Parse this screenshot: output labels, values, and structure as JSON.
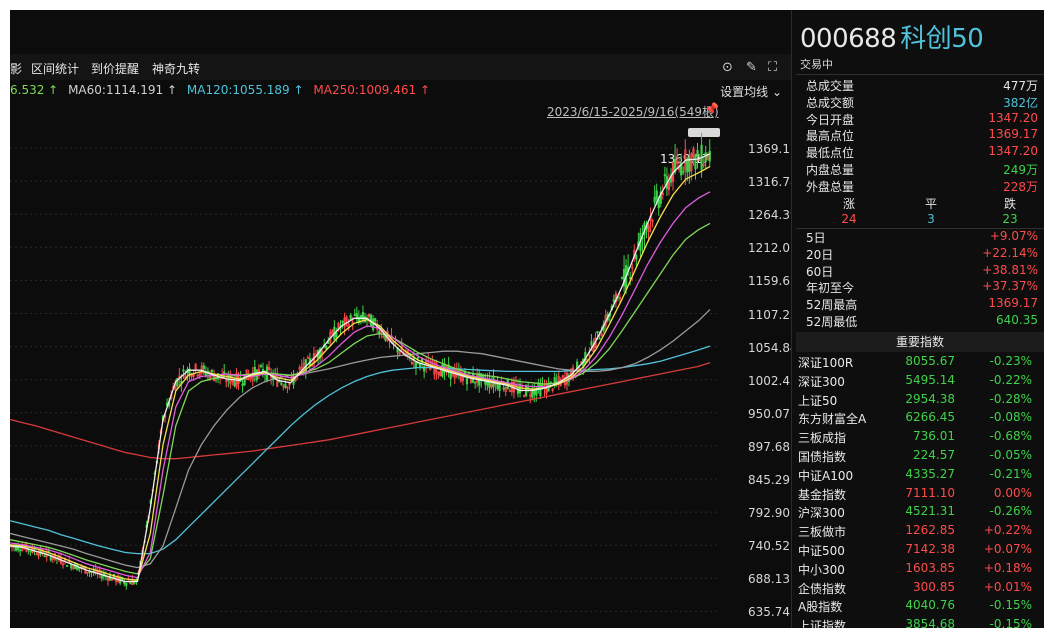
{
  "toolbar": {
    "items": [
      "影",
      "区间统计",
      "到价提醒",
      "神奇九转"
    ],
    "icons": [
      "settings-circle-icon",
      "draw-icon",
      "fullscreen-icon"
    ]
  },
  "ma": {
    "ma30_partial": "6.532 ↑",
    "ma60": "MA60:1114.191 ↑",
    "ma120": "MA120:1055.189 ↑",
    "ma250": "MA250:1009.461 ↑",
    "settings_label": "设置均线 ⌄"
  },
  "range": "2023/6/15-2025/9/16(549根)",
  "price_tag": "1369.17",
  "y_ticks": [
    "1369.17",
    "1316.78",
    "1264.39",
    "1212.01",
    "1159.62",
    "1107.23",
    "1054.84",
    "1002.45",
    "950.07",
    "897.68",
    "845.29",
    "792.90",
    "740.52",
    "688.13",
    "635.74"
  ],
  "colors": {
    "up": "#ff4b4b",
    "down": "#3fd24a",
    "ma5": "#f0f0f0",
    "ma10": "#f5e04c",
    "ma20": "#e05ce0",
    "ma30": "#7ed957",
    "ma60": "#9a9a9a",
    "ma120": "#4fc3d9",
    "ma250": "#d73a3a"
  },
  "quote": {
    "code": "000688",
    "name": "科创50",
    "status": "交易中",
    "stats": [
      {
        "label": "总成交量",
        "value": "477万",
        "color": "white"
      },
      {
        "label": "总成交额",
        "value": "382亿",
        "color": "cyan"
      },
      {
        "label": "今日开盘",
        "value": "1347.20",
        "color": "red"
      },
      {
        "label": "最高点位",
        "value": "1369.17",
        "color": "red"
      },
      {
        "label": "最低点位",
        "value": "1347.20",
        "color": "red"
      },
      {
        "label": "内盘总量",
        "value": "249万",
        "color": "green"
      },
      {
        "label": "外盘总量",
        "value": "228万",
        "color": "red"
      }
    ],
    "breadth": {
      "up_label": "涨",
      "flat_label": "平",
      "down_label": "跌",
      "up": "24",
      "flat": "3",
      "down": "23"
    },
    "perf": [
      {
        "label": "5日",
        "value": "+9.07%"
      },
      {
        "label": "20日",
        "value": "+22.14%"
      },
      {
        "label": "60日",
        "value": "+38.81%"
      },
      {
        "label": "年初至今",
        "value": "+37.37%"
      },
      {
        "label": "52周最高",
        "value": "1369.17"
      },
      {
        "label": "52周最低",
        "value": "640.35",
        "color": "green"
      }
    ]
  },
  "indices": {
    "header": "重要指数",
    "rows": [
      {
        "name": "深证100R",
        "price": "8055.67",
        "change": "-0.23%",
        "dir": "down"
      },
      {
        "name": "深证300",
        "price": "5495.14",
        "change": "-0.22%",
        "dir": "down"
      },
      {
        "name": "上证50",
        "price": "2954.38",
        "change": "-0.28%",
        "dir": "down"
      },
      {
        "name": "东方财富全A",
        "price": "6266.45",
        "change": "-0.08%",
        "dir": "down"
      },
      {
        "name": "三板成指",
        "price": "736.01",
        "change": "-0.68%",
        "dir": "down"
      },
      {
        "name": "国债指数",
        "price": "224.57",
        "change": "-0.05%",
        "dir": "down"
      },
      {
        "name": "中证A100",
        "price": "4335.27",
        "change": "-0.21%",
        "dir": "down"
      },
      {
        "name": "基金指数",
        "price": "7111.10",
        "change": "0.00%",
        "dir": "flat"
      },
      {
        "name": "沪深300",
        "price": "4521.31",
        "change": "-0.26%",
        "dir": "down"
      },
      {
        "name": "三板做市",
        "price": "1262.85",
        "change": "+0.22%",
        "dir": "up"
      },
      {
        "name": "中证500",
        "price": "7142.38",
        "change": "+0.07%",
        "dir": "up"
      },
      {
        "name": "中小300",
        "price": "1603.85",
        "change": "+0.18%",
        "dir": "up"
      },
      {
        "name": "企债指数",
        "price": "300.85",
        "change": "+0.01%",
        "dir": "up"
      },
      {
        "name": "A股指数",
        "price": "4040.76",
        "change": "-0.15%",
        "dir": "down"
      },
      {
        "name": "上证指数",
        "price": "3854.68",
        "change": "-0.15%",
        "dir": "down"
      }
    ]
  },
  "chart_data": {
    "type": "line",
    "ylim": [
      635.74,
      1369.17
    ],
    "x": [
      0,
      10,
      20,
      30,
      40,
      50,
      60,
      70,
      80,
      90,
      100,
      110,
      120,
      130,
      140,
      150,
      160,
      170,
      180,
      190,
      200,
      210,
      220,
      230,
      240,
      250,
      260,
      270,
      280,
      290,
      300,
      310,
      320,
      330,
      340,
      350,
      360,
      370,
      380,
      390,
      400,
      410,
      420,
      430,
      440,
      450,
      460,
      470,
      480,
      490,
      500,
      510,
      520,
      530,
      540,
      549
    ],
    "series": [
      {
        "name": "MA250",
        "values": [
          940,
          935,
          930,
          924,
          918,
          912,
          906,
          900,
          894,
          888,
          884,
          880,
          878,
          878,
          880,
          882,
          884,
          886,
          888,
          890,
          893,
          896,
          899,
          902,
          905,
          908,
          912,
          916,
          920,
          924,
          928,
          932,
          936,
          940,
          944,
          948,
          952,
          956,
          960,
          964,
          968,
          972,
          976,
          980,
          984,
          988,
          992,
          996,
          1000,
          1004,
          1008,
          1012,
          1016,
          1020,
          1024,
          1030
        ]
      },
      {
        "name": "MA120",
        "values": [
          780,
          775,
          770,
          765,
          758,
          752,
          746,
          740,
          735,
          730,
          728,
          728,
          735,
          750,
          770,
          790,
          810,
          830,
          850,
          870,
          890,
          910,
          930,
          948,
          964,
          978,
          990,
          1000,
          1008,
          1014,
          1018,
          1020,
          1022,
          1022,
          1021,
          1020,
          1019,
          1018,
          1017,
          1016,
          1016,
          1016,
          1016,
          1016,
          1017,
          1018,
          1019,
          1020,
          1022,
          1025,
          1028,
          1032,
          1038,
          1044,
          1050,
          1056
        ]
      },
      {
        "name": "MA60",
        "values": [
          760,
          755,
          750,
          745,
          740,
          735,
          728,
          722,
          716,
          710,
          706,
          712,
          740,
          800,
          860,
          900,
          930,
          955,
          975,
          990,
          1000,
          1006,
          1010,
          1012,
          1016,
          1020,
          1025,
          1030,
          1034,
          1038,
          1040,
          1042,
          1044,
          1046,
          1048,
          1048,
          1046,
          1044,
          1040,
          1036,
          1032,
          1028,
          1024,
          1020,
          1018,
          1016,
          1016,
          1018,
          1022,
          1028,
          1038,
          1050,
          1064,
          1080,
          1096,
          1114
        ]
      },
      {
        "name": "MA30",
        "values": [
          750,
          746,
          742,
          738,
          732,
          725,
          718,
          712,
          706,
          700,
          696,
          720,
          820,
          930,
          985,
          1000,
          1005,
          1008,
          1010,
          1012,
          1014,
          1012,
          1010,
          1014,
          1020,
          1030,
          1045,
          1060,
          1072,
          1076,
          1070,
          1058,
          1046,
          1036,
          1028,
          1020,
          1014,
          1010,
          1008,
          1004,
          1000,
          998,
          996,
          998,
          1004,
          1014,
          1030,
          1052,
          1080,
          1110,
          1140,
          1170,
          1200,
          1225,
          1240,
          1250
        ]
      },
      {
        "name": "MA20",
        "values": [
          745,
          742,
          738,
          734,
          728,
          720,
          712,
          706,
          700,
          694,
          690,
          730,
          860,
          960,
          1000,
          1008,
          1010,
          1012,
          1010,
          1008,
          1012,
          1010,
          1006,
          1012,
          1024,
          1040,
          1060,
          1078,
          1088,
          1084,
          1070,
          1054,
          1040,
          1030,
          1022,
          1016,
          1010,
          1006,
          1002,
          998,
          994,
          992,
          992,
          996,
          1004,
          1018,
          1040,
          1070,
          1105,
          1145,
          1185,
          1220,
          1250,
          1275,
          1290,
          1300
        ]
      },
      {
        "name": "MA10",
        "values": [
          742,
          740,
          736,
          730,
          722,
          714,
          706,
          700,
          694,
          688,
          686,
          760,
          900,
          985,
          1010,
          1016,
          1012,
          1008,
          1004,
          1010,
          1014,
          1006,
          1002,
          1016,
          1032,
          1054,
          1076,
          1092,
          1098,
          1088,
          1066,
          1048,
          1034,
          1026,
          1020,
          1014,
          1008,
          1004,
          1000,
          996,
          990,
          988,
          990,
          996,
          1006,
          1024,
          1052,
          1090,
          1130,
          1175,
          1220,
          1260,
          1295,
          1320,
          1330,
          1340
        ]
      },
      {
        "name": "MA5",
        "values": [
          740,
          738,
          732,
          726,
          718,
          710,
          702,
          696,
          690,
          684,
          684,
          800,
          940,
          1000,
          1018,
          1018,
          1010,
          1004,
          1002,
          1012,
          1016,
          1002,
          998,
          1020,
          1040,
          1066,
          1088,
          1100,
          1100,
          1084,
          1060,
          1042,
          1030,
          1024,
          1018,
          1012,
          1006,
          1002,
          998,
          994,
          986,
          986,
          990,
          998,
          1010,
          1032,
          1066,
          1106,
          1150,
          1200,
          1250,
          1295,
          1330,
          1350,
          1352,
          1360
        ]
      }
    ]
  }
}
